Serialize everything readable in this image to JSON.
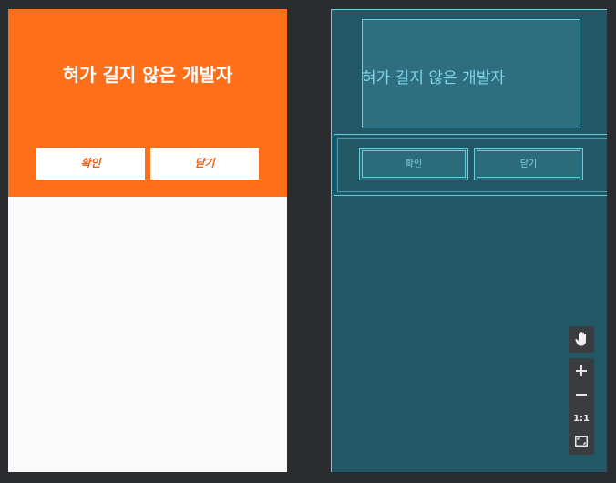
{
  "design": {
    "title": "혀가 길지 않은 개발자",
    "buttons": {
      "confirm": "확인",
      "close": "닫기"
    },
    "colors": {
      "header": "#ff6f1a",
      "button_text": "#e8641a",
      "background": "#fafafa"
    }
  },
  "blueprint": {
    "title": "혀가 길지 않은 개발자",
    "buttons": {
      "confirm": "확인",
      "close": "닫기"
    },
    "colors": {
      "background": "#225766",
      "outline": "#69cde0"
    }
  },
  "zoom_controls": {
    "pan_icon": "hand-icon",
    "zoom_in_icon": "plus-icon",
    "zoom_out_icon": "minus-icon",
    "actual_size_label": "1:1",
    "fit_icon": "fit-screen-icon"
  }
}
